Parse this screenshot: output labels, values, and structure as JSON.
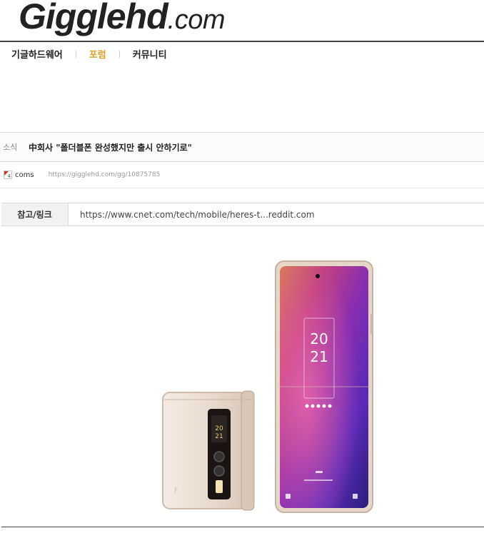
{
  "site": {
    "logo_main": "Gigglehd",
    "logo_suffix": ".com"
  },
  "nav": {
    "items": [
      {
        "label": "기글하드웨어",
        "active": false
      },
      {
        "label": "포럼",
        "active": true
      },
      {
        "label": "커뮤니티",
        "active": false
      }
    ]
  },
  "post": {
    "category": "소식",
    "title": "中회사 \"폴더블폰 완성했지만 출시 안하기로\"",
    "author": "coms",
    "url": "https://gigglehd.com/gg/10875785",
    "reference": {
      "label": "참고/링크",
      "link_text": "https://www.cnet.com/tech/mobile/heres-t...reddit.com"
    },
    "image": {
      "icon": "folding-phone-image",
      "cover_clock": "20 21",
      "screen_clock_hour": "20",
      "screen_clock_minute": "21",
      "brand_mark": "F"
    }
  },
  "colors": {
    "nav_active": "#e0a020",
    "logo": "#222222",
    "phone_body": "#eadfd6"
  }
}
